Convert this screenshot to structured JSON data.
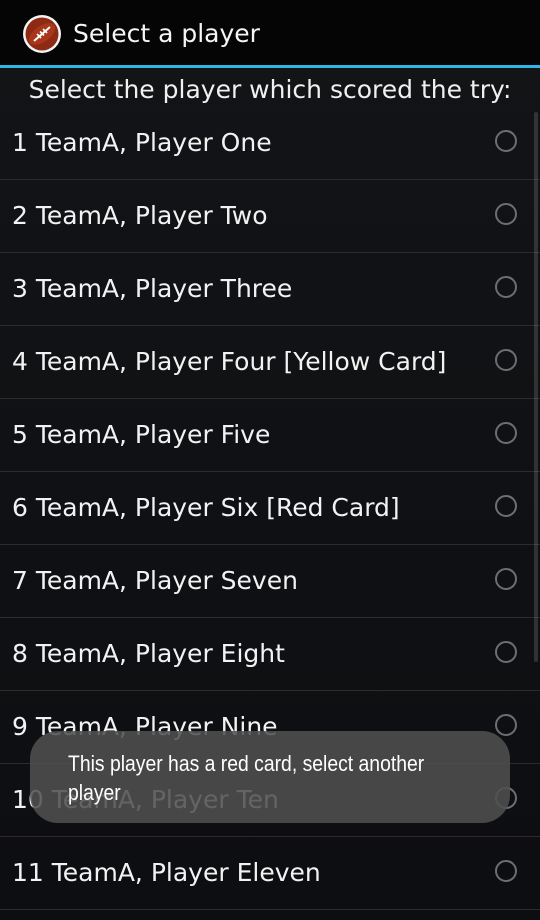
{
  "action_bar": {
    "title": "Select a player",
    "icon": "football-icon"
  },
  "prompt": "Select the player which scored the try:",
  "players": [
    {
      "label": "1 TeamA, Player One",
      "selected": false
    },
    {
      "label": "2 TeamA, Player Two",
      "selected": false
    },
    {
      "label": "3 TeamA, Player Three",
      "selected": false
    },
    {
      "label": "4 TeamA, Player Four [Yellow Card]",
      "selected": false
    },
    {
      "label": "5 TeamA, Player Five",
      "selected": false
    },
    {
      "label": "6 TeamA, Player Six [Red Card]",
      "selected": false
    },
    {
      "label": "7 TeamA, Player Seven",
      "selected": false
    },
    {
      "label": "8 TeamA, Player Eight",
      "selected": false
    },
    {
      "label": "9 TeamA, Player Nine",
      "selected": false
    },
    {
      "label": "10 TeamA, Player Ten",
      "selected": false
    },
    {
      "label": "11 TeamA, Player Eleven",
      "selected": false
    }
  ],
  "toast": {
    "message": "This player has a red card, select another player"
  },
  "colors": {
    "accent": "#33b5e5",
    "background": "#0d0e11",
    "divider": "#2a2c30",
    "toast_bg": "#505050"
  }
}
